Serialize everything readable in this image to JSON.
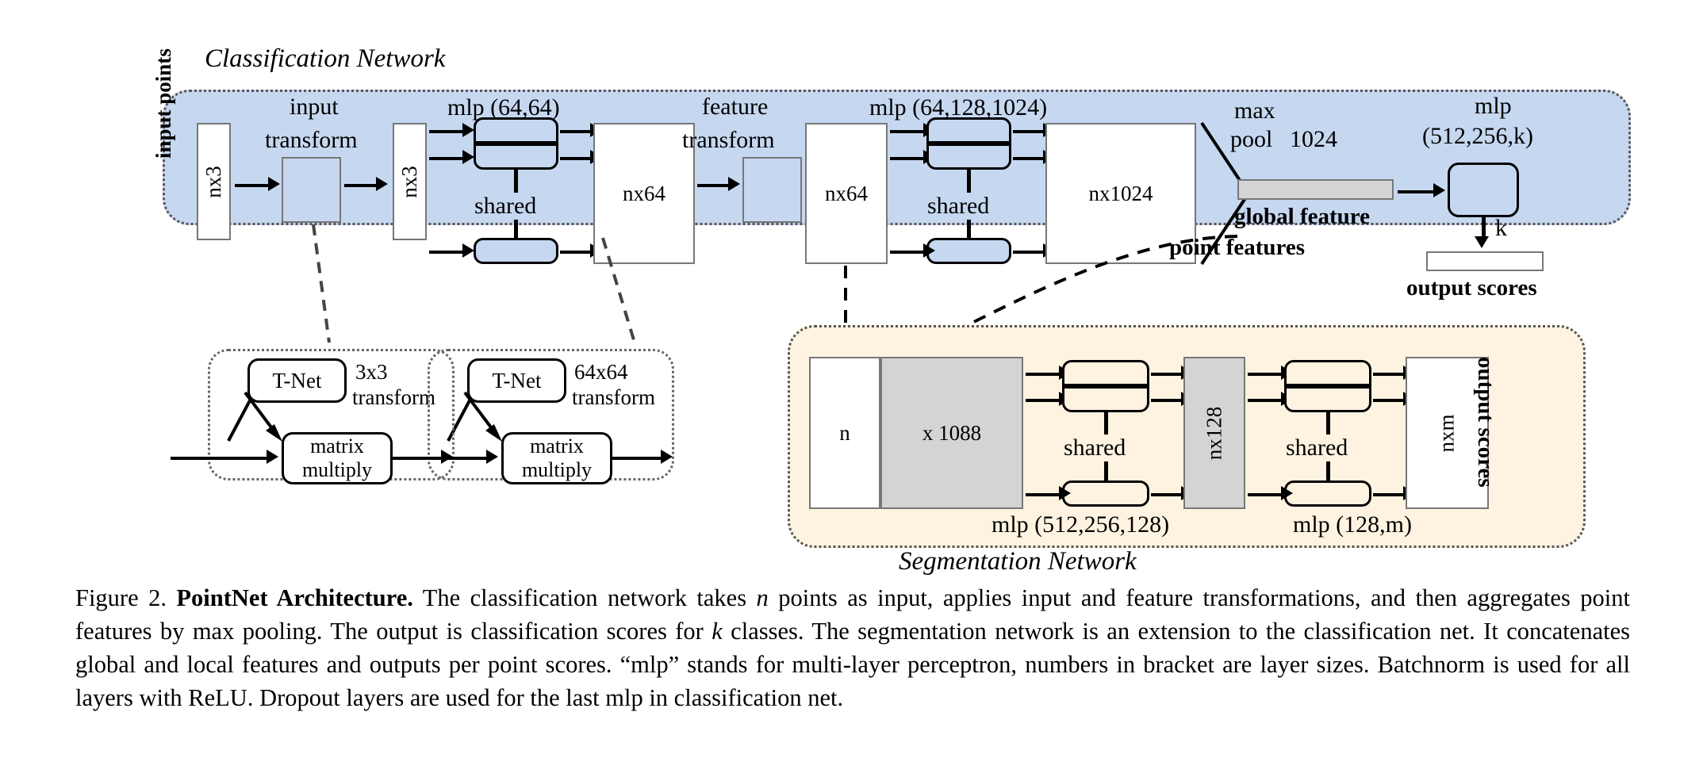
{
  "figure": {
    "classification_network_title": "Classification Network",
    "segmentation_network_title": "Segmentation Network"
  },
  "classification": {
    "input_points_label": "input points",
    "input_tensor": "nx3",
    "input_transform_label_line1": "input",
    "input_transform_label_line2": "transform",
    "transformed_tensor": "nx3",
    "mlp1_label": "mlp (64,64)",
    "mlp1_shared": "shared",
    "feat_tensor": "nx64",
    "feature_transform_label_line1": "feature",
    "feature_transform_label_line2": "transform",
    "feat_tensor2": "nx64",
    "mlp2_label": "mlp (64,128,1024)",
    "mlp2_shared": "shared",
    "big_tensor": "nx1024",
    "maxpool_line1": "max",
    "maxpool_line2": "pool",
    "global_feature_size": "1024",
    "global_feature_label": "global feature",
    "mlp3_label_line1": "mlp",
    "mlp3_label_line2": "(512,256,k)",
    "k_label": "k",
    "output_scores_label": "output scores"
  },
  "tnet_input": {
    "tnet_label": "T-Net",
    "transform_label_line1": "3x3",
    "transform_label_line2": "transform",
    "matmul_line1": "matrix",
    "matmul_line2": "multiply"
  },
  "tnet_feature": {
    "tnet_label": "T-Net",
    "transform_label_line1": "64x64",
    "transform_label_line2": "transform",
    "matmul_line1": "matrix",
    "matmul_line2": "multiply"
  },
  "segmentation": {
    "point_features_label": "point features",
    "concat_n_label": "n",
    "concat_dim_label": "x 1088",
    "mlp4_label": "mlp (512,256,128)",
    "mlp4_shared": "shared",
    "mid_tensor": "nx128",
    "mlp5_label": "mlp (128,m)",
    "mlp5_shared": "shared",
    "out_tensor": "nxm",
    "output_scores_label": "output scores"
  },
  "caption": {
    "figure_number": "Figure 2.",
    "title": "PointNet Architecture.",
    "body_1": " The classification network takes ",
    "math_n": "n",
    "body_2": " points as input, applies input and feature transformations, and then aggregates point features by max pooling. The output is classification scores for ",
    "math_k": "k",
    "body_3": " classes. The segmentation network is an extension to the classification net. It concatenates global and local features and outputs per point scores. “mlp” stands for multi-layer perceptron, numbers in bracket are layer sizes. Batchnorm is used for all layers with ReLU. Dropout layers are used for the last mlp in classification net."
  },
  "colors": {
    "classification_panel": "#c6d7f0",
    "segmentation_panel": "#fdf3e0",
    "global_feature_bar": "#d4d4d4",
    "concat_gray": "#d4d4d4"
  }
}
